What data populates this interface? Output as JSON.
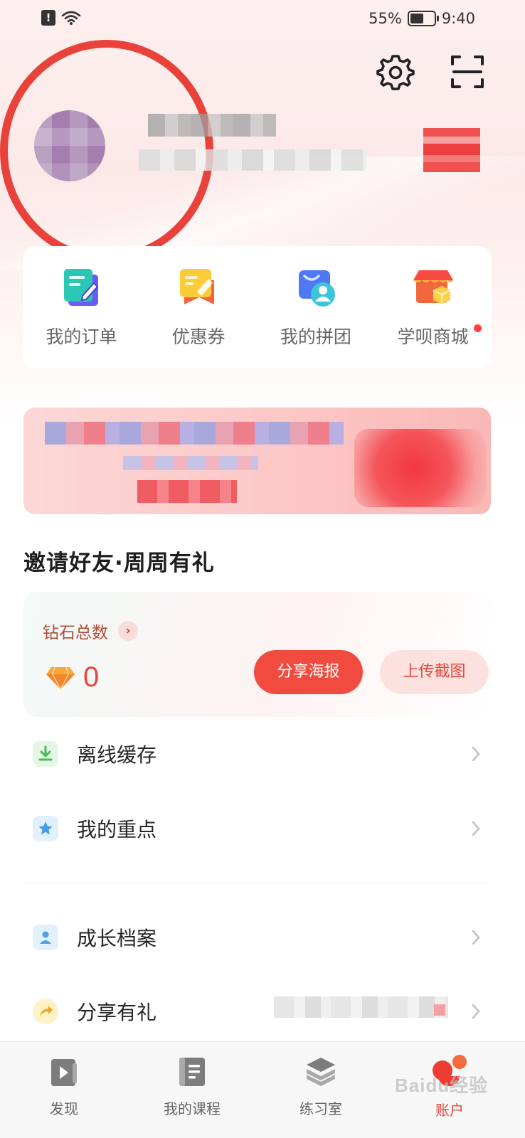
{
  "status_bar": {
    "battery_percent": "55%",
    "battery_level": 0.55,
    "time": "9:40",
    "icons": [
      "alert-icon",
      "wifi-icon",
      "battery-icon"
    ]
  },
  "header": {
    "icons": [
      "settings-gear-icon",
      "scan-icon"
    ]
  },
  "profile": {
    "name": "",
    "subtitle": "",
    "badge": ""
  },
  "quick_actions": [
    {
      "label": "我的订单",
      "icon": "order-document-icon"
    },
    {
      "label": "优惠券",
      "icon": "coupon-icon"
    },
    {
      "label": "我的拼团",
      "icon": "group-buy-icon"
    },
    {
      "label": "学呗商城",
      "icon": "store-icon",
      "has_dot": true
    }
  ],
  "invite": {
    "title": "邀请好友·周周有礼",
    "diamond_label": "钻石总数",
    "diamond_count": "0",
    "share_button": "分享海报",
    "upload_button": "上传截图"
  },
  "menu": [
    {
      "label": "离线缓存",
      "icon": "download-icon"
    },
    {
      "label": "我的重点",
      "icon": "star-bookmark-icon"
    },
    {
      "label": "成长档案",
      "icon": "profile-card-icon"
    },
    {
      "label": "分享有礼",
      "icon": "share-arrow-icon"
    }
  ],
  "tabbar": [
    {
      "label": "发现",
      "icon": "video-play-icon",
      "active": false
    },
    {
      "label": "我的课程",
      "icon": "course-book-icon",
      "active": false
    },
    {
      "label": "练习室",
      "icon": "layers-stack-icon",
      "active": false
    },
    {
      "label": "账户",
      "icon": "account-icon",
      "active": true
    }
  ],
  "watermark": "Baidu经验",
  "colors": {
    "accent": "#f14a3e",
    "accent_light": "#fde1df",
    "annotation_circle": "#e8423a",
    "tab_active": "#e8453b"
  }
}
